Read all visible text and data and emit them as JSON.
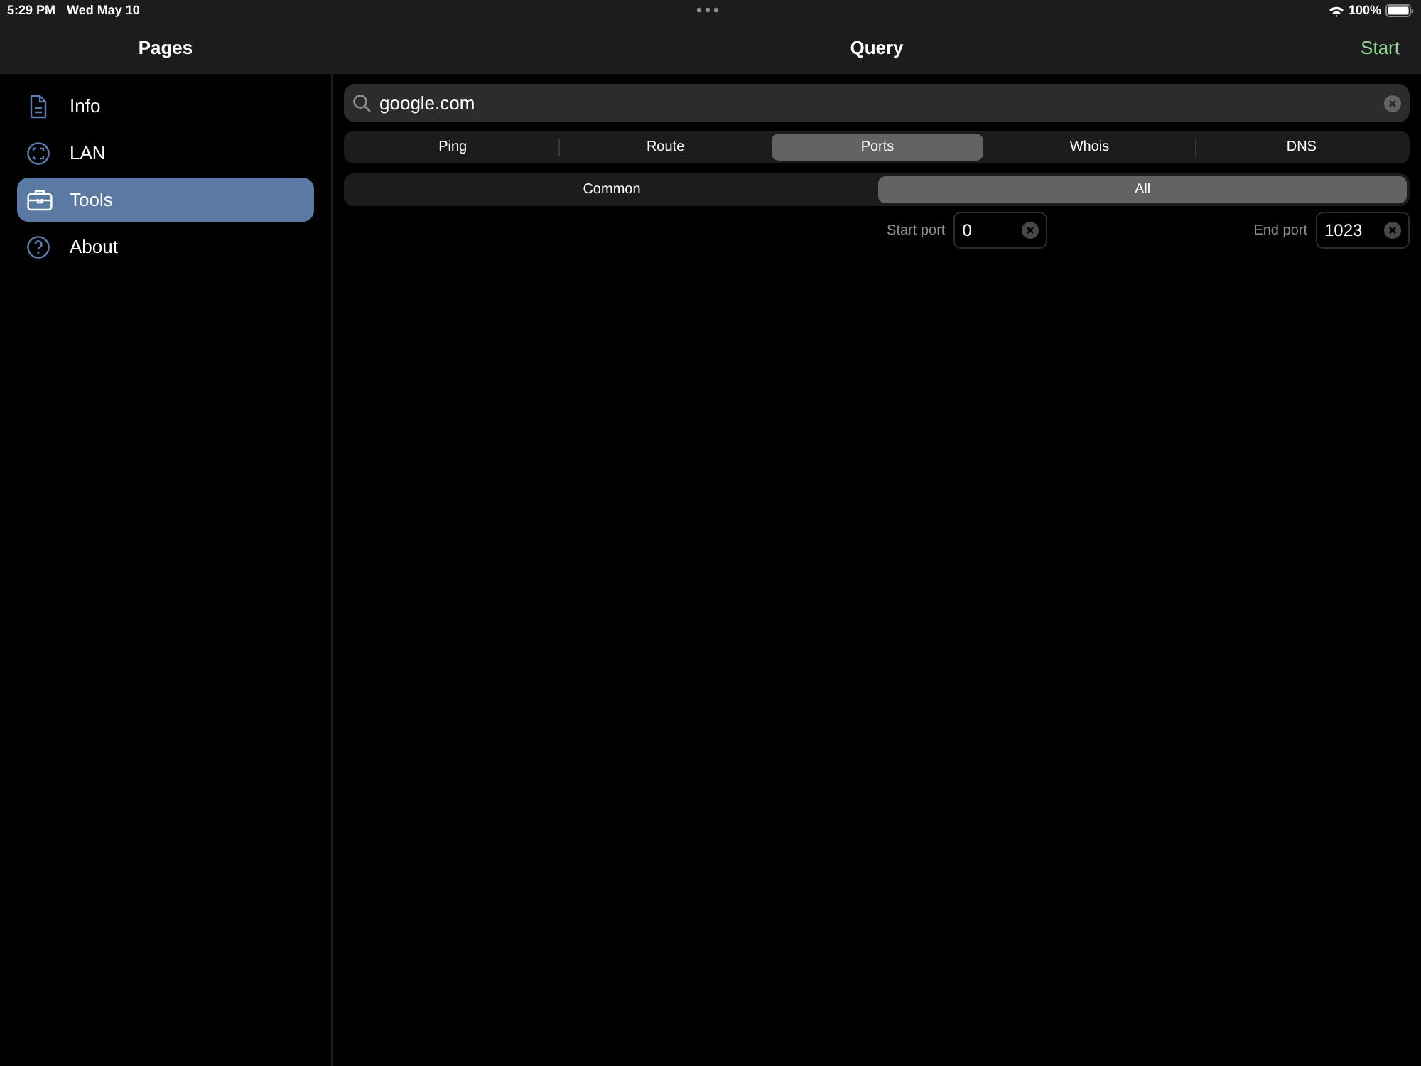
{
  "status_bar": {
    "time": "5:29 PM",
    "date": "Wed May 10",
    "battery": "100%"
  },
  "sidebar": {
    "title": "Pages",
    "items": [
      {
        "label": "Info",
        "kind": "document",
        "selected": false
      },
      {
        "label": "LAN",
        "kind": "network",
        "selected": false
      },
      {
        "label": "Tools",
        "kind": "toolbox",
        "selected": true
      },
      {
        "label": "About",
        "kind": "help",
        "selected": false
      }
    ]
  },
  "main": {
    "title": "Query",
    "action": "Start",
    "search": {
      "value": "google.com"
    },
    "tabs": [
      {
        "label": "Ping",
        "selected": false
      },
      {
        "label": "Route",
        "selected": false
      },
      {
        "label": "Ports",
        "selected": true
      },
      {
        "label": "Whois",
        "selected": false
      },
      {
        "label": "DNS",
        "selected": false
      }
    ],
    "scope": [
      {
        "label": "Common",
        "selected": false
      },
      {
        "label": "All",
        "selected": true
      }
    ],
    "ports": [
      {
        "label": "Start port",
        "value": "0"
      },
      {
        "label": "End port",
        "value": "1023"
      }
    ]
  }
}
